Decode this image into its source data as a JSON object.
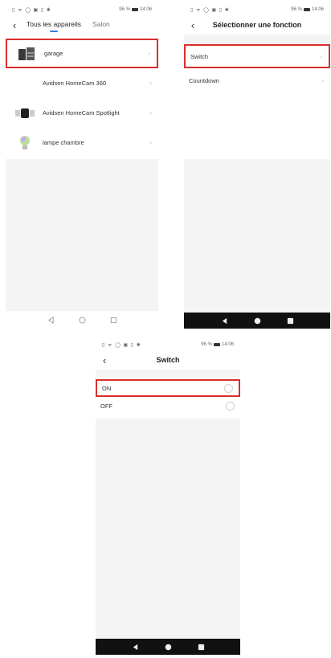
{
  "status_bar": {
    "battery": "96 %",
    "time": "14:06"
  },
  "screen1": {
    "tabs": [
      {
        "label": "Tous les appareils",
        "active": true
      },
      {
        "label": "Salon",
        "active": false
      }
    ],
    "devices": [
      {
        "name": "garage",
        "icon": "garage-door-icon",
        "selected": true
      },
      {
        "name": "Avidsen HomeCam 360",
        "icon": "none",
        "selected": false
      },
      {
        "name": "Avidsen HomeCam Spotlight",
        "icon": "camera-spotlight-icon",
        "selected": false
      },
      {
        "name": "lampe chambre",
        "icon": "lightbulb-icon",
        "selected": false
      }
    ]
  },
  "screen2": {
    "title": "Sélectionner une fonction",
    "functions": [
      {
        "name": "Switch",
        "selected": true
      },
      {
        "name": "Countdown",
        "selected": false
      }
    ]
  },
  "screen3": {
    "title": "Switch",
    "options": [
      {
        "name": "ON",
        "selected": true
      },
      {
        "name": "OFF",
        "selected": false
      }
    ]
  },
  "colors": {
    "highlight": "#d9302b",
    "tab_indicator": "#2f7de1",
    "background_gray": "#f4f4f4"
  }
}
